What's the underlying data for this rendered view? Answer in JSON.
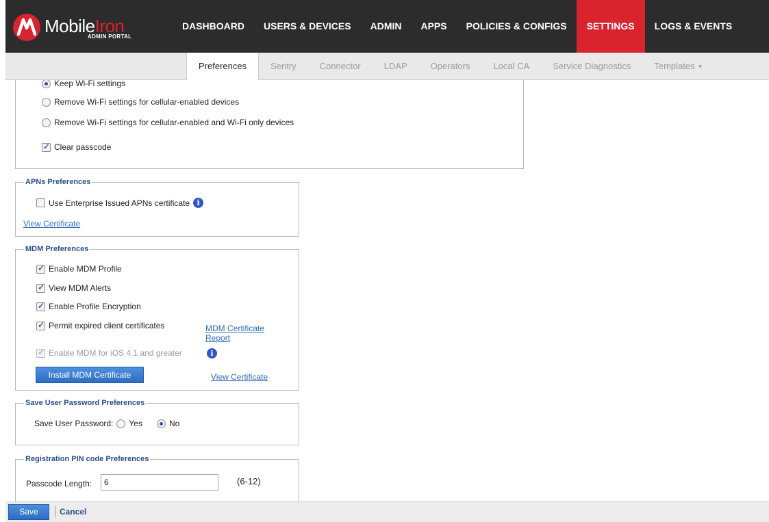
{
  "brand": {
    "name_part1": "Mobile",
    "name_part2": "Iron",
    "subtitle": "ADMIN PORTAL",
    "accent_color": "#d9232f"
  },
  "nav": {
    "items": [
      {
        "label": "DASHBOARD"
      },
      {
        "label": "USERS & DEVICES"
      },
      {
        "label": "ADMIN"
      },
      {
        "label": "APPS"
      },
      {
        "label": "POLICIES & CONFIGS"
      },
      {
        "label": "SETTINGS"
      },
      {
        "label": "LOGS & EVENTS"
      }
    ],
    "active": "SETTINGS"
  },
  "subnav": {
    "items": [
      {
        "label": "Preferences"
      },
      {
        "label": "Sentry"
      },
      {
        "label": "Connector"
      },
      {
        "label": "LDAP"
      },
      {
        "label": "Operators"
      },
      {
        "label": "Local CA"
      },
      {
        "label": "Service Diagnostics"
      },
      {
        "label": "Templates"
      }
    ],
    "active": "Preferences"
  },
  "wipe": {
    "keep_wifi": "Keep Wi-Fi settings",
    "remove_cellular": "Remove Wi-Fi settings for cellular-enabled devices",
    "remove_all": "Remove Wi-Fi settings for cellular-enabled and Wi-Fi only devices",
    "clear_passcode": "Clear passcode"
  },
  "apns": {
    "title": "APNs Preferences",
    "use_enterprise": "Use Enterprise Issued APNs certificate",
    "view_certificate": "View Certificate"
  },
  "mdm": {
    "title": "MDM Preferences",
    "enable_profile": "Enable MDM Profile",
    "view_alerts": "View MDM Alerts",
    "enable_encryption": "Enable Profile Encryption",
    "permit_expired": "Permit expired client certificates",
    "cert_report_line1": "MDM Certificate",
    "cert_report_line2": "Report",
    "enable_ios": "Enable MDM for iOS 4.1 and greater",
    "install_button": "Install MDM Certificate",
    "view_certificate": "View Certificate"
  },
  "password": {
    "title": "Save User Password Preferences",
    "label": "Save User Password:",
    "yes": "Yes",
    "no": "No"
  },
  "pin": {
    "title": "Registration PIN code Preferences",
    "label": "Passcode Length:",
    "value": "6",
    "range": "(6-12)"
  },
  "footer": {
    "save": "Save",
    "cancel": "Cancel"
  }
}
